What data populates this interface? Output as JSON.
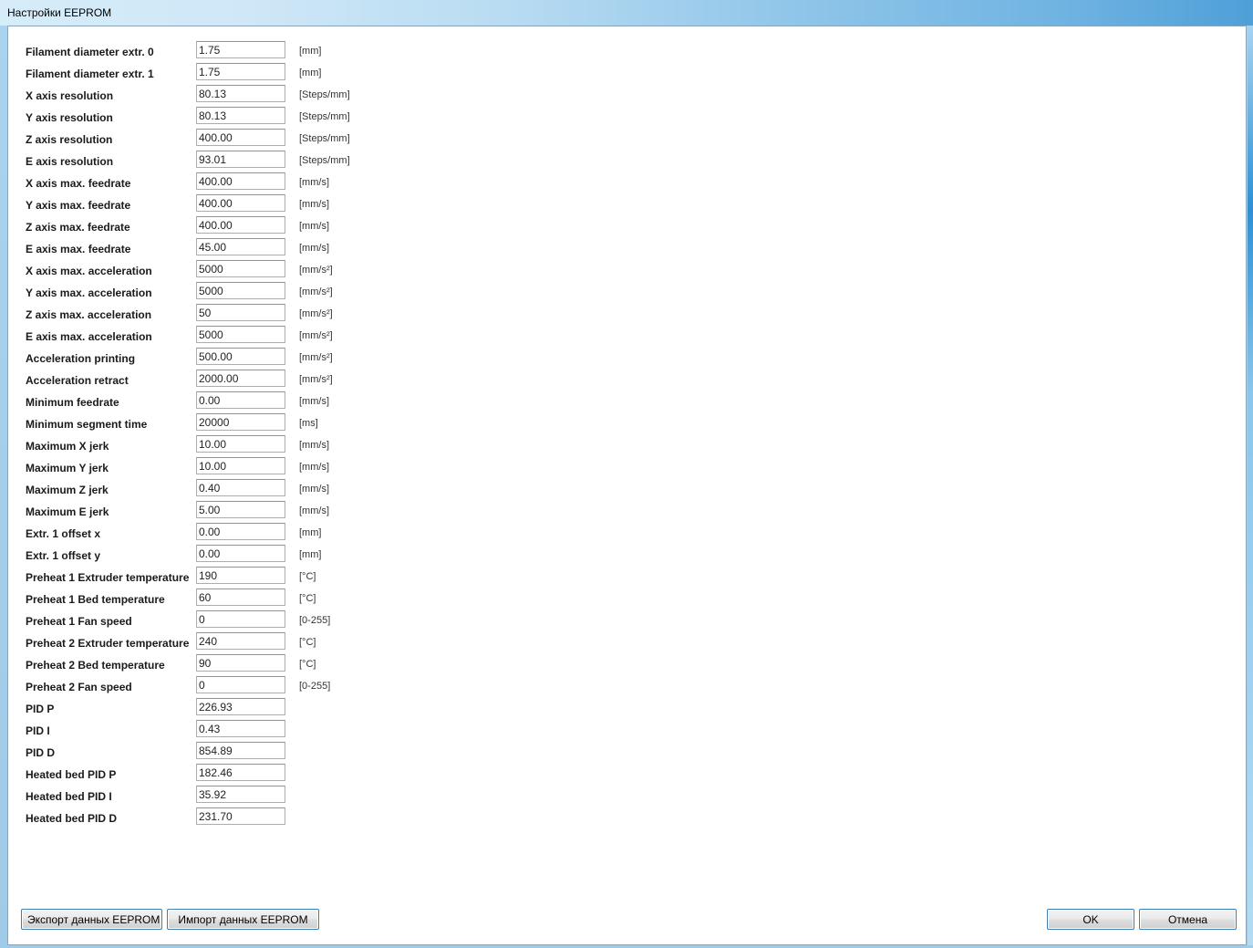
{
  "window": {
    "title": "Настройки EEPROM"
  },
  "settings": [
    {
      "label": "Filament diameter extr. 0",
      "value": "1.75",
      "unit": "[mm]"
    },
    {
      "label": "Filament diameter extr. 1",
      "value": "1.75",
      "unit": "[mm]"
    },
    {
      "label": "X axis resolution",
      "value": "80.13",
      "unit": "[Steps/mm]"
    },
    {
      "label": "Y axis resolution",
      "value": "80.13",
      "unit": "[Steps/mm]"
    },
    {
      "label": "Z axis resolution",
      "value": "400.00",
      "unit": "[Steps/mm]"
    },
    {
      "label": "E axis resolution",
      "value": "93.01",
      "unit": "[Steps/mm]"
    },
    {
      "label": "X axis max. feedrate",
      "value": "400.00",
      "unit": "[mm/s]"
    },
    {
      "label": "Y axis max. feedrate",
      "value": "400.00",
      "unit": "[mm/s]"
    },
    {
      "label": "Z axis max. feedrate",
      "value": "400.00",
      "unit": "[mm/s]"
    },
    {
      "label": "E axis max. feedrate",
      "value": "45.00",
      "unit": "[mm/s]"
    },
    {
      "label": "X axis max. acceleration",
      "value": "5000",
      "unit": "[mm/s²]"
    },
    {
      "label": "Y axis max. acceleration",
      "value": "5000",
      "unit": "[mm/s²]"
    },
    {
      "label": "Z axis max. acceleration",
      "value": "50",
      "unit": "[mm/s²]"
    },
    {
      "label": "E axis max. acceleration",
      "value": "5000",
      "unit": "[mm/s²]"
    },
    {
      "label": "Acceleration printing",
      "value": "500.00",
      "unit": "[mm/s²]"
    },
    {
      "label": "Acceleration retract",
      "value": "2000.00",
      "unit": "[mm/s²]"
    },
    {
      "label": "Minimum feedrate",
      "value": "0.00",
      "unit": "[mm/s]"
    },
    {
      "label": "Minimum segment time",
      "value": "20000",
      "unit": "[ms]"
    },
    {
      "label": "Maximum X jerk",
      "value": "10.00",
      "unit": "[mm/s]"
    },
    {
      "label": "Maximum Y jerk",
      "value": "10.00",
      "unit": "[mm/s]"
    },
    {
      "label": "Maximum Z jerk",
      "value": "0.40",
      "unit": "[mm/s]"
    },
    {
      "label": "Maximum E jerk",
      "value": "5.00",
      "unit": "[mm/s]"
    },
    {
      "label": "Extr. 1 offset x",
      "value": "0.00",
      "unit": "[mm]"
    },
    {
      "label": "Extr. 1 offset y",
      "value": "0.00",
      "unit": "[mm]"
    },
    {
      "label": "Preheat 1 Extruder temperature",
      "value": "190",
      "unit": "[°C]"
    },
    {
      "label": "Preheat 1 Bed temperature",
      "value": "60",
      "unit": "[°C]"
    },
    {
      "label": "Preheat 1 Fan speed",
      "value": "0",
      "unit": "[0-255]"
    },
    {
      "label": "Preheat 2 Extruder temperature",
      "value": "240",
      "unit": "[°C]"
    },
    {
      "label": "Preheat 2 Bed temperature",
      "value": "90",
      "unit": "[°C]"
    },
    {
      "label": "Preheat 2 Fan speed",
      "value": "0",
      "unit": "[0-255]"
    },
    {
      "label": "PID P",
      "value": "226.93",
      "unit": ""
    },
    {
      "label": "PID I",
      "value": "0.43",
      "unit": ""
    },
    {
      "label": "PID D",
      "value": "854.89",
      "unit": ""
    },
    {
      "label": "Heated bed PID P",
      "value": "182.46",
      "unit": ""
    },
    {
      "label": "Heated bed PID I",
      "value": "35.92",
      "unit": ""
    },
    {
      "label": "Heated bed PID D",
      "value": "231.70",
      "unit": ""
    }
  ],
  "buttons": {
    "export": "Экспорт данных EEPROM",
    "import": "Импорт данных EEPROM",
    "ok": "OK",
    "cancel": "Отмена"
  }
}
